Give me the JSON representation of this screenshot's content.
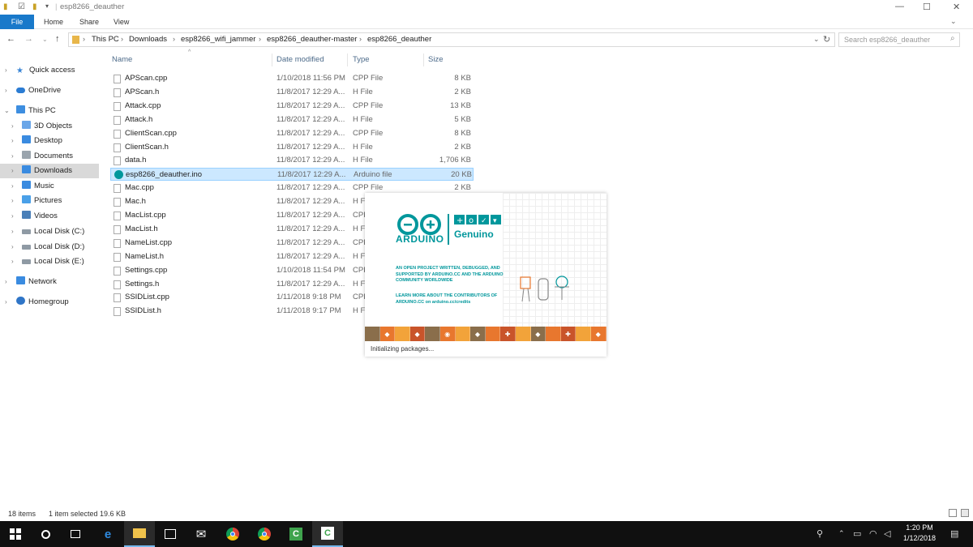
{
  "window": {
    "title": "esp8266_deauther",
    "controls": {
      "minimize": "—",
      "maximize": "☐",
      "close": "✕"
    }
  },
  "ribbon": {
    "tabs": [
      "File",
      "Home",
      "Share",
      "View"
    ]
  },
  "address": {
    "crumbs": [
      "This PC",
      "Downloads",
      "esp8266_wifi_jammer",
      "esp8266_deauther-master",
      "esp8266_deauther"
    ],
    "search_placeholder": "Search esp8266_deauther"
  },
  "nav": {
    "items": [
      {
        "label": "Quick access",
        "icon": "star-icon",
        "color": "#3a85d6",
        "selected": false
      },
      {
        "label": "OneDrive",
        "icon": "cloud-icon",
        "color": "#2b7cd3",
        "selected": false
      },
      {
        "label": "This PC",
        "icon": "computer-icon",
        "color": "#3d8ee0",
        "selected": false
      },
      {
        "label": "3D Objects",
        "icon": "cube-icon",
        "color": "#6aa6e8",
        "selected": false
      },
      {
        "label": "Desktop",
        "icon": "desktop-icon",
        "color": "#3a8be0",
        "selected": false
      },
      {
        "label": "Documents",
        "icon": "document-icon",
        "color": "#9aa4ad",
        "selected": false
      },
      {
        "label": "Downloads",
        "icon": "download-icon",
        "color": "#3a8be0",
        "selected": true
      },
      {
        "label": "Music",
        "icon": "music-icon",
        "color": "#3a8be0",
        "selected": false
      },
      {
        "label": "Pictures",
        "icon": "picture-icon",
        "color": "#4aa0e8",
        "selected": false
      },
      {
        "label": "Videos",
        "icon": "video-icon",
        "color": "#4a7fb8",
        "selected": false
      },
      {
        "label": "Local Disk (C:)",
        "icon": "drive-icon",
        "color": "#8f9aa4",
        "selected": false
      },
      {
        "label": "Local Disk (D:)",
        "icon": "drive-icon",
        "color": "#8f9aa4",
        "selected": false
      },
      {
        "label": "Local Disk (E:)",
        "icon": "drive-icon",
        "color": "#8f9aa4",
        "selected": false
      },
      {
        "label": "Network",
        "icon": "network-icon",
        "color": "#3a8be0",
        "selected": false
      },
      {
        "label": "Homegroup",
        "icon": "homegroup-icon",
        "color": "#2f75c7",
        "selected": false
      }
    ]
  },
  "files": {
    "columns": [
      "Name",
      "Date modified",
      "Type",
      "Size"
    ],
    "rows": [
      {
        "name": "APScan.cpp",
        "date": "1/10/2018 11:56 PM",
        "type": "CPP File",
        "size": "8 KB"
      },
      {
        "name": "APScan.h",
        "date": "11/8/2017 12:29 A...",
        "type": "H File",
        "size": "2 KB"
      },
      {
        "name": "Attack.cpp",
        "date": "11/8/2017 12:29 A...",
        "type": "CPP File",
        "size": "13 KB"
      },
      {
        "name": "Attack.h",
        "date": "11/8/2017 12:29 A...",
        "type": "H File",
        "size": "5 KB"
      },
      {
        "name": "ClientScan.cpp",
        "date": "11/8/2017 12:29 A...",
        "type": "CPP File",
        "size": "8 KB"
      },
      {
        "name": "ClientScan.h",
        "date": "11/8/2017 12:29 A...",
        "type": "H File",
        "size": "2 KB"
      },
      {
        "name": "data.h",
        "date": "11/8/2017 12:29 A...",
        "type": "H File",
        "size": "1,706 KB"
      },
      {
        "name": "esp8266_deauther.ino",
        "date": "11/8/2017 12:29 A...",
        "type": "Arduino file",
        "size": "20 KB"
      },
      {
        "name": "Mac.cpp",
        "date": "11/8/2017 12:29 A...",
        "type": "CPP File",
        "size": "2 KB"
      },
      {
        "name": "Mac.h",
        "date": "11/8/2017 12:29 A...",
        "type": "H File",
        "size": ""
      },
      {
        "name": "MacList.cpp",
        "date": "11/8/2017 12:29 A...",
        "type": "CPP File",
        "size": ""
      },
      {
        "name": "MacList.h",
        "date": "11/8/2017 12:29 A...",
        "type": "H File",
        "size": ""
      },
      {
        "name": "NameList.cpp",
        "date": "11/8/2017 12:29 A...",
        "type": "CPP File",
        "size": ""
      },
      {
        "name": "NameList.h",
        "date": "11/8/2017 12:29 A...",
        "type": "H File",
        "size": ""
      },
      {
        "name": "Settings.cpp",
        "date": "1/10/2018 11:54 PM",
        "type": "CPP File",
        "size": ""
      },
      {
        "name": "Settings.h",
        "date": "11/8/2017 12:29 A...",
        "type": "H File",
        "size": ""
      },
      {
        "name": "SSIDList.cpp",
        "date": "1/11/2018 9:18 PM",
        "type": "CPP File",
        "size": ""
      },
      {
        "name": "SSIDList.h",
        "date": "1/11/2018 9:17 PM",
        "type": "H File",
        "size": ""
      }
    ],
    "selected_index": 7
  },
  "status": {
    "count": "18 items",
    "selection": "1 item selected  19.6 KB"
  },
  "splash": {
    "brand": "ARDUINO",
    "genuino": "Genuino",
    "tagline": "AN OPEN PROJECT WRITTEN, DEBUGGED, AND SUPPORTED BY ARDUINO.CC AND THE ARDUINO COMMUNITY WORLDWIDE",
    "learn_more": "LEARN MORE ABOUT THE CONTRIBUTORS OF ARDUINO.CC on arduino.cc/credits",
    "loading": "Initializing packages...",
    "strip_colors": [
      "#8a6e4b",
      "#e8772e",
      "#f2a33a",
      "#c9542a",
      "#8a6e4b",
      "#e8772e",
      "#f2a33a",
      "#8a6e4b",
      "#e8772e",
      "#c9542a",
      "#f2a33a",
      "#8a6e4b",
      "#e8772e",
      "#c9542a",
      "#f2a33a",
      "#e8772e"
    ]
  },
  "taskbar": {
    "time": "1:20 PM",
    "date": "1/12/2018"
  }
}
